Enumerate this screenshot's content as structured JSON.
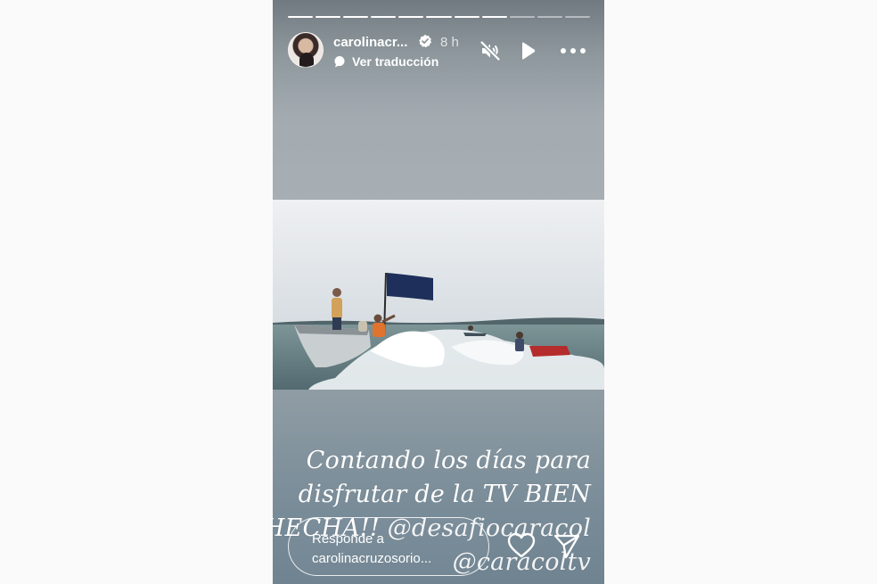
{
  "story": {
    "progress": {
      "total": 11,
      "completed": 8
    },
    "header": {
      "username": "carolinacr...",
      "time": "8 h",
      "translate_label": "Ver traducción",
      "icons": [
        "verified-badge-icon",
        "mute-icon",
        "play-icon",
        "more-options-icon",
        "translate-icon"
      ]
    },
    "caption": {
      "line1": "Contando los días para",
      "line2": "disfrutar de la TV BIEN",
      "line3_text": "HECHA!! ",
      "mention1": "@desafiocaracol",
      "mention2": "@caracoltv"
    },
    "reply": {
      "line1": "Responde a",
      "line2": "carolinacruzosorio..."
    },
    "colors": {
      "text": "#ffffff",
      "page_background": "#fafafa"
    }
  }
}
